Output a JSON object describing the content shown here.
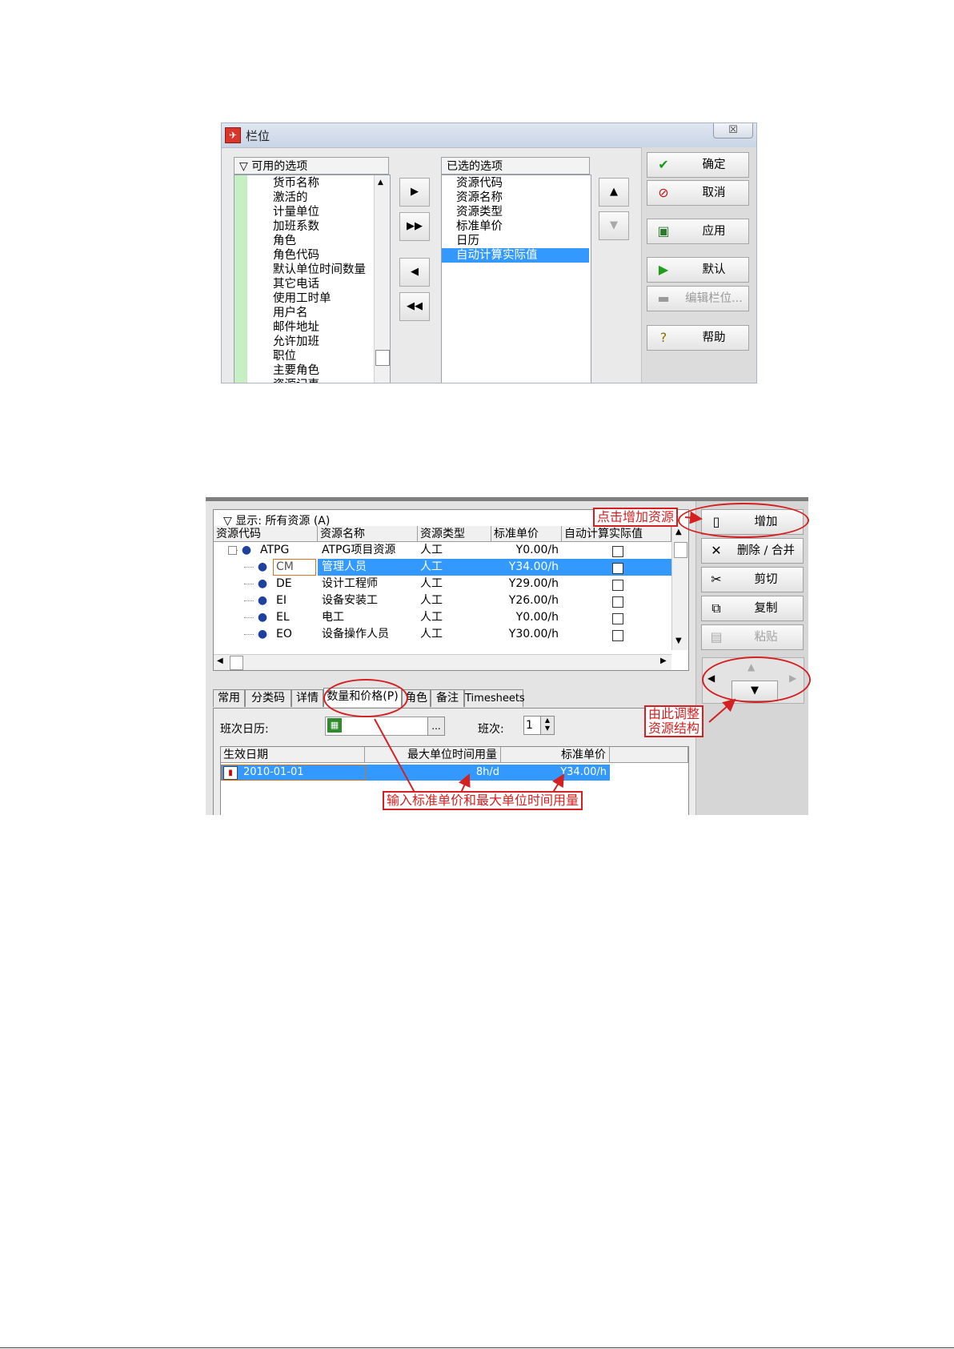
{
  "dialog1": {
    "title": "栏位",
    "close_label": "☒",
    "available": {
      "header": "▽ 可用的选项",
      "items": [
        "货币名称",
        "激活的",
        "计量单位",
        "加班系数",
        "角色",
        "角色代码",
        "默认单位时间数量",
        "其它电话",
        "使用工时单",
        "用户名",
        "邮件地址",
        "允许加班",
        "职位",
        "主要角色",
        "资源记事"
      ]
    },
    "selected": {
      "header": "已选的选项",
      "items": [
        "资源代码",
        "资源名称",
        "资源类型",
        "标准单价",
        "日历",
        "自动计算实际值"
      ],
      "selected_item": "自动计算实际值"
    },
    "move_buttons": [
      "▶",
      "▶▶",
      "◀",
      "◀◀"
    ],
    "order_buttons": [
      "▲",
      "▼"
    ],
    "actions": [
      {
        "label": "确定",
        "icon": "✔",
        "color": "#1a9a1a",
        "disabled": false
      },
      {
        "label": "取消",
        "icon": "⊘",
        "color": "#c0151a",
        "disabled": false
      },
      {
        "label": "应用",
        "icon": "▣",
        "color": "#2b7a2b",
        "disabled": false
      },
      {
        "label": "默认",
        "icon": "▶",
        "color": "#1e9e1e",
        "disabled": false
      },
      {
        "label": "编辑栏位...",
        "icon": "▬",
        "color": "#999999",
        "disabled": true
      },
      {
        "label": "帮助",
        "icon": "?",
        "color": "#8a6d00",
        "disabled": false
      }
    ]
  },
  "window2": {
    "filter": "▽ 显示: 所有资源 (A)",
    "columns": [
      "资源代码",
      "资源名称",
      "资源类型",
      "标准单价",
      "自动计算实际值"
    ],
    "rows": [
      {
        "code": "ATPG",
        "name": "ATPG项目资源",
        "type": "人工",
        "price": "Y0.00/h",
        "selected": false
      },
      {
        "code": "CM",
        "name": "管理人员",
        "type": "人工",
        "price": "Y34.00/h",
        "selected": true
      },
      {
        "code": "DE",
        "name": "设计工程师",
        "type": "人工",
        "price": "Y29.00/h",
        "selected": false
      },
      {
        "code": "EI",
        "name": "设备安装工",
        "type": "人工",
        "price": "Y26.00/h",
        "selected": false
      },
      {
        "code": "EL",
        "name": "电工",
        "type": "人工",
        "price": "Y0.00/h",
        "selected": false
      },
      {
        "code": "EO",
        "name": "设备操作人员",
        "type": "人工",
        "price": "Y30.00/h",
        "selected": false
      }
    ],
    "tabs": [
      "常用",
      "分类码",
      "详情",
      "数量和价格(P)",
      "角色",
      "备注",
      "Timesheets"
    ],
    "active_tab": "数量和价格(P)",
    "calendar_label": "班次日历:",
    "shift_label": "班次:",
    "shift_value": "1",
    "browse_label": "...",
    "sub_columns": [
      "生效日期",
      "最大单位时间用量",
      "标准单价"
    ],
    "sub_row": {
      "date": "2010-01-01",
      "max_units": "8h/d",
      "price": "Y34.00/h"
    },
    "buttons": [
      {
        "label": "增加",
        "icon": "▯",
        "disabled": false
      },
      {
        "label": "删除 / 合并",
        "icon": "✕",
        "disabled": false
      },
      {
        "label": "剪切",
        "icon": "✂",
        "disabled": false
      },
      {
        "label": "复制",
        "icon": "⧉",
        "disabled": false
      },
      {
        "label": "粘贴",
        "icon": "▤",
        "disabled": true
      }
    ],
    "nav_arrows": [
      "◀",
      "▲",
      "▶",
      "▼"
    ]
  },
  "annotations": {
    "add": "点击增加资源",
    "structure_line1": "由此调整",
    "structure_line2": "资源结构",
    "input": "输入标准单价和最大单位时间用量"
  }
}
